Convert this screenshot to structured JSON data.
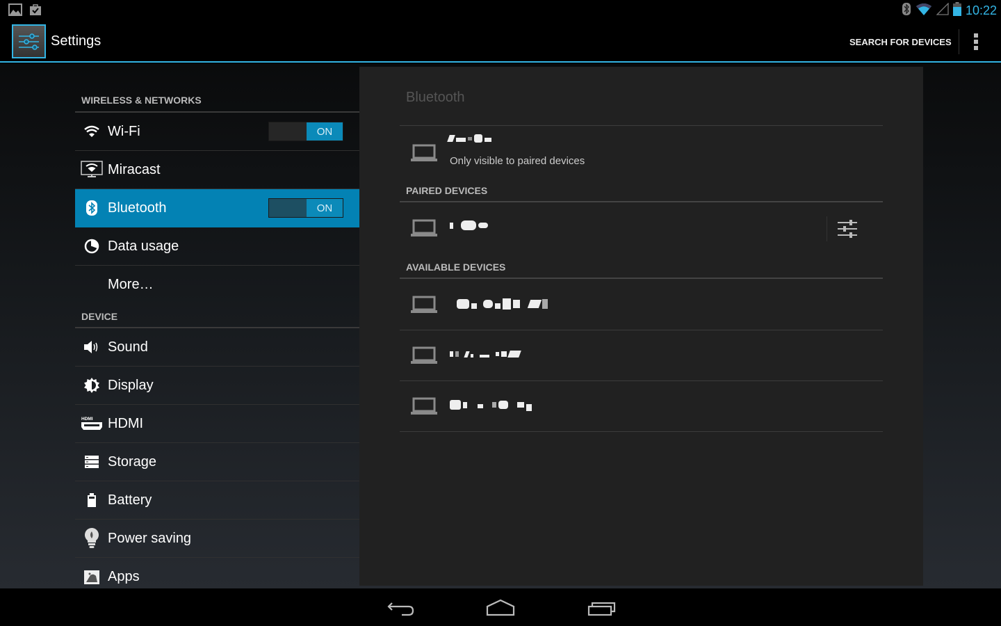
{
  "status_bar": {
    "left_icons": [
      "gallery-icon",
      "store-check-icon"
    ],
    "right_icons": [
      "bluetooth-icon",
      "wifi-icon",
      "cell-signal-icon",
      "battery-icon"
    ],
    "time": "10:22"
  },
  "action_bar": {
    "title": "Settings",
    "search_label": "SEARCH FOR DEVICES",
    "overflow_icon": "overflow-menu-icon"
  },
  "sidebar": {
    "sections": [
      {
        "header": "WIRELESS & NETWORKS",
        "items": [
          {
            "label": "Wi-Fi",
            "icon": "wifi-icon",
            "toggle": "ON"
          },
          {
            "label": "Miracast",
            "icon": "miracast-icon"
          },
          {
            "label": "Bluetooth",
            "icon": "bluetooth-icon",
            "toggle": "ON",
            "active": true
          },
          {
            "label": "Data usage",
            "icon": "data-usage-icon"
          },
          {
            "label": "More…"
          }
        ]
      },
      {
        "header": "DEVICE",
        "items": [
          {
            "label": "Sound",
            "icon": "sound-icon"
          },
          {
            "label": "Display",
            "icon": "display-icon"
          },
          {
            "label": "HDMI",
            "icon": "hdmi-icon"
          },
          {
            "label": "Storage",
            "icon": "storage-icon"
          },
          {
            "label": "Battery",
            "icon": "battery-icon"
          },
          {
            "label": "Power saving",
            "icon": "power-saving-icon"
          },
          {
            "label": "Apps",
            "icon": "apps-icon"
          }
        ]
      }
    ]
  },
  "bluetooth_panel": {
    "title": "Bluetooth",
    "this_device": {
      "name": "[redacted]",
      "visibility": "Only visible to paired devices"
    },
    "paired_header": "PAIRED DEVICES",
    "paired_devices": [
      {
        "name": "[redacted]",
        "icon": "laptop-icon",
        "settings_icon": "device-settings-icon"
      }
    ],
    "available_header": "AVAILABLE DEVICES",
    "available_devices": [
      {
        "name": "[redacted]",
        "icon": "laptop-icon"
      },
      {
        "name": "[redacted]",
        "icon": "laptop-icon"
      },
      {
        "name": "[redacted]",
        "icon": "laptop-icon"
      }
    ]
  },
  "nav_bar": {
    "buttons": [
      "back",
      "home",
      "recent-apps"
    ]
  },
  "colors": {
    "accent": "#33b5e5",
    "active_item": "#0382b4",
    "toggle_on": "#0b8ab9",
    "panel_bg": "#212121"
  }
}
